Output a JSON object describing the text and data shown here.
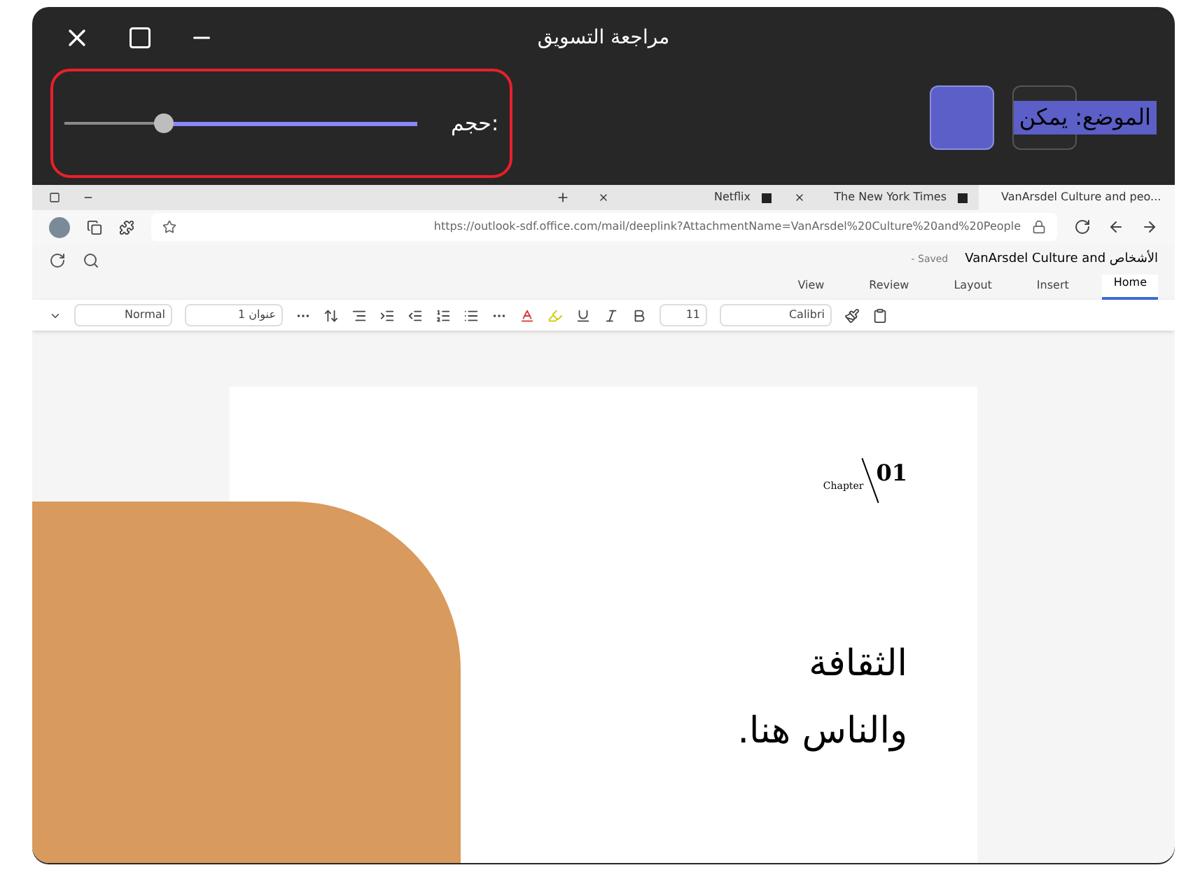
{
  "window": {
    "title": "مراجعة التسويق"
  },
  "volume": {
    "label": "حجم:",
    "level": 0.72
  },
  "mode_toggle": {
    "label": "الموضع: يمكن",
    "on": true
  },
  "browser": {
    "tabs": [
      {
        "label": "VanArsdel Culture and peo...",
        "selected": true
      },
      {
        "label": "The New York Times",
        "selected": false
      },
      {
        "label": "Netflix",
        "selected": false
      }
    ],
    "url": "https://outlook-sdf.office.com/mail/deeplink?AttachmentName=VanArsdel%20Culture%20and%20People"
  },
  "document": {
    "title": "VanArsdel Culture and الأشخاص",
    "status": "- Saved",
    "ribbon_tabs": [
      {
        "label": "Home",
        "selected": true
      },
      {
        "label": "Insert",
        "selected": false
      },
      {
        "label": "Layout",
        "selected": false
      },
      {
        "label": "Review",
        "selected": false
      },
      {
        "label": "View",
        "selected": false
      }
    ],
    "font": "Calibri",
    "font_size": "11",
    "styles": [
      "عنوان 1",
      "Normal"
    ],
    "chapter_number": "01",
    "chapter_label": "Chapter",
    "heading_lines": [
      "الثقافة",
      "والناس هنا."
    ]
  }
}
